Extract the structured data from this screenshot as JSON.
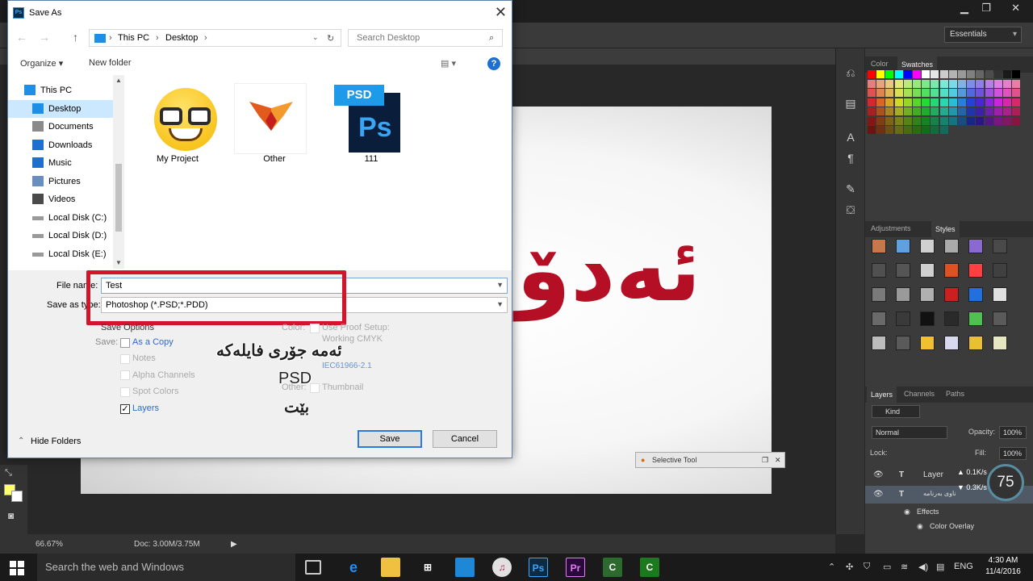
{
  "photoshop": {
    "workspace": "Essentials",
    "zoom": "66.67%",
    "doc_info": "Doc: 3.00M/3.75M",
    "canvas_text": "ئەدۆ",
    "panels": {
      "color_tab": "Color",
      "swatches_tab": "Swatches",
      "adjustments_tab": "Adjustments",
      "styles_tab": "Styles",
      "layers_tab": "Layers",
      "channels_tab": "Channels",
      "paths_tab": "Paths",
      "kind_filter": "Kind",
      "blend_mode": "Normal",
      "opacity_label": "Opacity:",
      "opacity_value": "100%",
      "lock_label": "Lock:",
      "fill_label": "Fill:",
      "fill_value": "100%",
      "layer_1": "Layer",
      "layer_2": "ناوی بەرنامە",
      "effects_label": "Effects",
      "color_overlay": "Color Overlay"
    },
    "selective_tool": "Selective Tool",
    "net_monitor": {
      "percent": "75",
      "up": "0.1K/s",
      "down": "0.3K/s"
    }
  },
  "dialog": {
    "title": "Save As",
    "breadcrumb": [
      "This PC",
      "Desktop"
    ],
    "search_placeholder": "Search Desktop",
    "organize": "Organize",
    "new_folder": "New folder",
    "help": "?",
    "nav_items": [
      {
        "label": "This PC",
        "icon": "computer-icon"
      },
      {
        "label": "Desktop",
        "icon": "desktop-icon"
      },
      {
        "label": "Documents",
        "icon": "documents-icon"
      },
      {
        "label": "Downloads",
        "icon": "download-icon"
      },
      {
        "label": "Music",
        "icon": "music-icon"
      },
      {
        "label": "Pictures",
        "icon": "pictures-icon"
      },
      {
        "label": "Videos",
        "icon": "videos-icon"
      },
      {
        "label": "Local Disk (C:)",
        "icon": "drive-icon"
      },
      {
        "label": "Local Disk (D:)",
        "icon": "drive-icon"
      },
      {
        "label": "Local Disk (E:)",
        "icon": "drive-icon"
      }
    ],
    "files": [
      {
        "label": "My Project"
      },
      {
        "label": "Other"
      },
      {
        "label": "111",
        "badge": "PSD",
        "glyph": "Ps"
      }
    ],
    "file_name_label": "File name:",
    "file_name_value": "Test",
    "save_as_type_label": "Save as type:",
    "save_as_type_value": "Photoshop (*.PSD;*.PDD)",
    "save_options": "Save Options",
    "save_label": "Save:",
    "as_a_copy": "As a Copy",
    "notes": "Notes",
    "alpha_channels": "Alpha Channels",
    "spot_colors": "Spot Colors",
    "layers": "Layers",
    "color_label": "Color:",
    "use_proof": "Use Proof Setup:",
    "working_cmyk": "Working CMYK",
    "icc_profile": "IEC61966-2.1",
    "other_label": "Other:",
    "thumbnail": "Thumbnail",
    "hide_folders": "Hide Folders",
    "save_button": "Save",
    "cancel_button": "Cancel"
  },
  "overlay": {
    "line1": "ئەمە جۆری فایلەکە",
    "line2": "PSD",
    "line3": "بێت"
  },
  "taskbar": {
    "search": "Search the web and Windows",
    "lang": "ENG",
    "time": "4:30 AM",
    "date": "11/4/2016"
  }
}
